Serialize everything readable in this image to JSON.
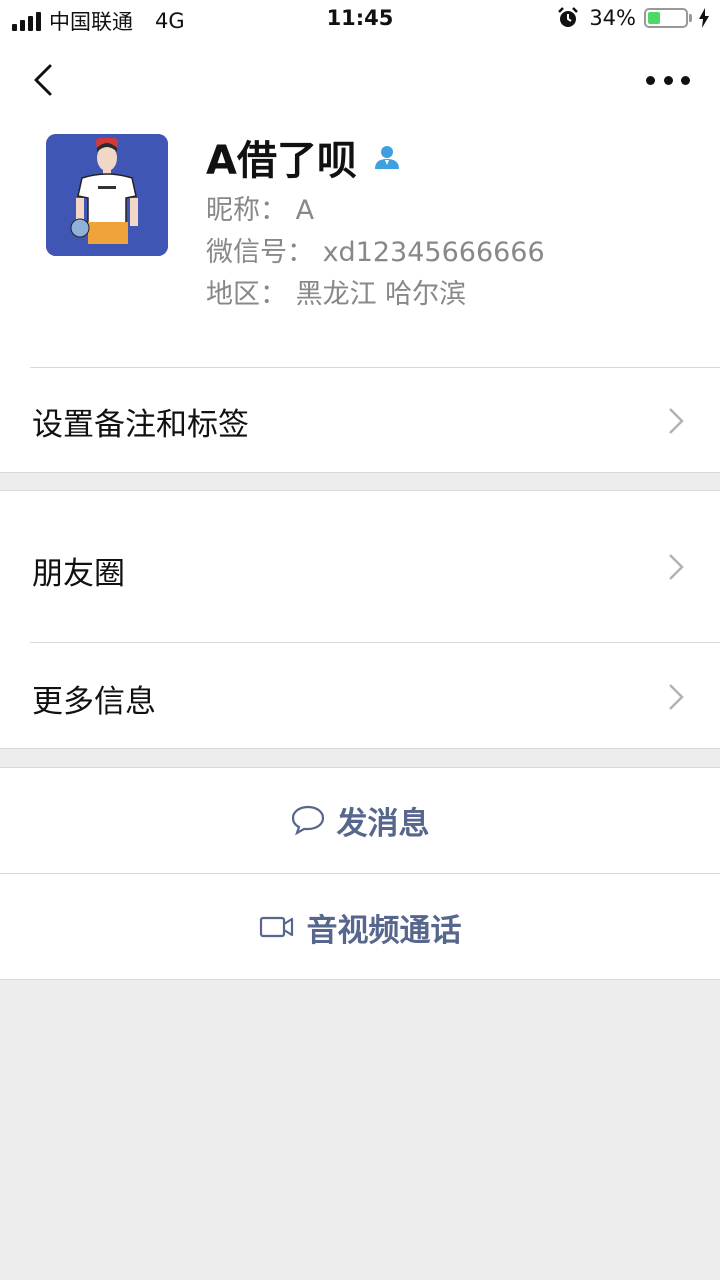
{
  "status_bar": {
    "carrier": "中国联通",
    "network": "4G",
    "time": "11:45",
    "battery_percent": "34%",
    "battery_level": 0.34,
    "battery_color": "#4cd964"
  },
  "profile": {
    "display_name": "A借了呗",
    "nickname": "昵称：  A",
    "wechat_id": "微信号：  xd12345666666",
    "region": "地区：  黑龙江 哈尔滨"
  },
  "menu": {
    "remark_tags": "设置备注和标签",
    "moments": "朋友圈",
    "more_info": "更多信息"
  },
  "actions": {
    "message": "发消息",
    "video_call": "音视频通话"
  },
  "colors": {
    "action_text": "#56668c",
    "contact_icon": "#3fa0e0",
    "avatar_bg": "#3f56b5"
  }
}
